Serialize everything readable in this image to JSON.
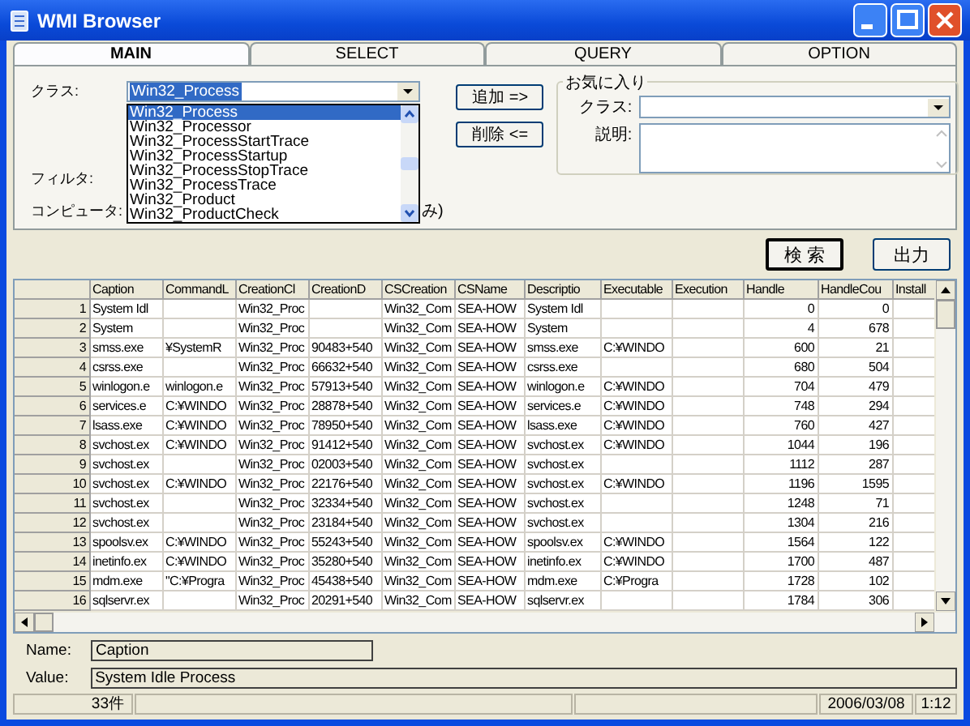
{
  "window": {
    "title": "WMI Browser"
  },
  "tabs": [
    {
      "label": "MAIN",
      "selected": true
    },
    {
      "label": "SELECT",
      "selected": false
    },
    {
      "label": "QUERY",
      "selected": false
    },
    {
      "label": "OPTION",
      "selected": false
    }
  ],
  "main": {
    "class_label": "クラス:",
    "class_value": "Win32_Process",
    "add_button": "追加 =>",
    "remove_button": "削除 <=",
    "filter_label": "フィルタ:",
    "computer_label": "コンピュータ:",
    "computer_tail": "み)",
    "class_list": [
      {
        "label": "Win32_Process",
        "selected": true
      },
      {
        "label": "Win32_Processor",
        "selected": false
      },
      {
        "label": "Win32_ProcessStartTrace",
        "selected": false
      },
      {
        "label": "Win32_ProcessStartup",
        "selected": false
      },
      {
        "label": "Win32_ProcessStopTrace",
        "selected": false
      },
      {
        "label": "Win32_ProcessTrace",
        "selected": false
      },
      {
        "label": "Win32_Product",
        "selected": false
      },
      {
        "label": "Win32_ProductCheck",
        "selected": false
      }
    ],
    "favorites": {
      "title": "お気に入り",
      "class_label": "クラス:",
      "description_label": "説明:"
    }
  },
  "buttons": {
    "search": "検 索",
    "output": "出力"
  },
  "table": {
    "columns": [
      "Caption",
      "CommandL",
      "CreationCl",
      "CreationD",
      "CSCreation",
      "CSName",
      "Descriptio",
      "Executable",
      "Execution",
      "Handle",
      "HandleCou",
      "Install"
    ],
    "rows": [
      {
        "number": "1",
        "cells": [
          "System Idl",
          "",
          "Win32_Proc",
          "",
          "Win32_Com",
          "SEA-HOW",
          "System Idl",
          "",
          "",
          "0",
          "0",
          ""
        ]
      },
      {
        "number": "2",
        "cells": [
          "System",
          "",
          "Win32_Proc",
          "",
          "Win32_Com",
          "SEA-HOW",
          "System",
          "",
          "",
          "4",
          "678",
          ""
        ]
      },
      {
        "number": "3",
        "cells": [
          "smss.exe",
          "¥SystemR",
          "Win32_Proc",
          "90483+540",
          "Win32_Com",
          "SEA-HOW",
          "smss.exe",
          "C:¥WINDO",
          "",
          "600",
          "21",
          ""
        ]
      },
      {
        "number": "4",
        "cells": [
          "csrss.exe",
          "",
          "Win32_Proc",
          "66632+540",
          "Win32_Com",
          "SEA-HOW",
          "csrss.exe",
          "",
          "",
          "680",
          "504",
          ""
        ]
      },
      {
        "number": "5",
        "cells": [
          "winlogon.e",
          "winlogon.e",
          "Win32_Proc",
          "57913+540",
          "Win32_Com",
          "SEA-HOW",
          "winlogon.e",
          "C:¥WINDO",
          "",
          "704",
          "479",
          ""
        ]
      },
      {
        "number": "6",
        "cells": [
          "services.e",
          "C:¥WINDO",
          "Win32_Proc",
          "28878+540",
          "Win32_Com",
          "SEA-HOW",
          "services.e",
          "C:¥WINDO",
          "",
          "748",
          "294",
          ""
        ]
      },
      {
        "number": "7",
        "cells": [
          "lsass.exe",
          "C:¥WINDO",
          "Win32_Proc",
          "78950+540",
          "Win32_Com",
          "SEA-HOW",
          "lsass.exe",
          "C:¥WINDO",
          "",
          "760",
          "427",
          ""
        ]
      },
      {
        "number": "8",
        "cells": [
          "svchost.ex",
          "C:¥WINDO",
          "Win32_Proc",
          "91412+540",
          "Win32_Com",
          "SEA-HOW",
          "svchost.ex",
          "C:¥WINDO",
          "",
          "1044",
          "196",
          ""
        ]
      },
      {
        "number": "9",
        "cells": [
          "svchost.ex",
          "",
          "Win32_Proc",
          "02003+540",
          "Win32_Com",
          "SEA-HOW",
          "svchost.ex",
          "",
          "",
          "1112",
          "287",
          ""
        ]
      },
      {
        "number": "10",
        "cells": [
          "svchost.ex",
          "C:¥WINDO",
          "Win32_Proc",
          "22176+540",
          "Win32_Com",
          "SEA-HOW",
          "svchost.ex",
          "C:¥WINDO",
          "",
          "1196",
          "1595",
          ""
        ]
      },
      {
        "number": "11",
        "cells": [
          "svchost.ex",
          "",
          "Win32_Proc",
          "32334+540",
          "Win32_Com",
          "SEA-HOW",
          "svchost.ex",
          "",
          "",
          "1248",
          "71",
          ""
        ]
      },
      {
        "number": "12",
        "cells": [
          "svchost.ex",
          "",
          "Win32_Proc",
          "23184+540",
          "Win32_Com",
          "SEA-HOW",
          "svchost.ex",
          "",
          "",
          "1304",
          "216",
          ""
        ]
      },
      {
        "number": "13",
        "cells": [
          "spoolsv.ex",
          "C:¥WINDO",
          "Win32_Proc",
          "55243+540",
          "Win32_Com",
          "SEA-HOW",
          "spoolsv.ex",
          "C:¥WINDO",
          "",
          "1564",
          "122",
          ""
        ]
      },
      {
        "number": "14",
        "cells": [
          "inetinfo.ex",
          "C:¥WINDO",
          "Win32_Proc",
          "35280+540",
          "Win32_Com",
          "SEA-HOW",
          "inetinfo.ex",
          "C:¥WINDO",
          "",
          "1700",
          "487",
          ""
        ]
      },
      {
        "number": "15",
        "cells": [
          "mdm.exe",
          "\"C:¥Progra",
          "Win32_Proc",
          "45438+540",
          "Win32_Com",
          "SEA-HOW",
          "mdm.exe",
          "C:¥Progra",
          "",
          "1728",
          "102",
          ""
        ]
      },
      {
        "number": "16",
        "cells": [
          "sqlservr.ex",
          "",
          "Win32_Proc",
          "20291+540",
          "Win32_Com",
          "SEA-HOW",
          "sqlservr.ex",
          "",
          "",
          "1784",
          "306",
          ""
        ]
      }
    ]
  },
  "details": {
    "name_label": "Name:",
    "name_value": "Caption",
    "value_label": "Value:",
    "value_value": "System Idle Process"
  },
  "status_bar": [
    {
      "kind": "text",
      "text": "33件"
    },
    {
      "kind": "blank"
    },
    {
      "kind": "blank"
    },
    {
      "kind": "text",
      "text": "2006/03/08"
    },
    {
      "kind": "text",
      "text": "1:12"
    }
  ]
}
